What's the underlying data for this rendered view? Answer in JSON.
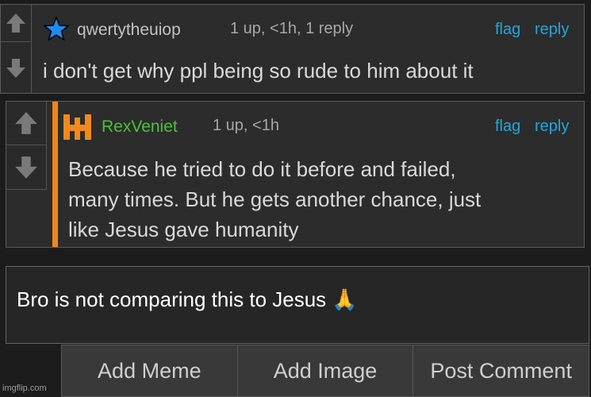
{
  "comments": [
    {
      "username": "qwertytheuiop",
      "meta": "1 up, <1h, 1 reply",
      "flag": "flag",
      "reply": "reply",
      "text": "i don't get why ppl being so rude to him about it"
    },
    {
      "username": "RexVeniet",
      "meta": "1 up, <1h",
      "flag": "flag",
      "reply": "reply",
      "lines": [
        "Because he tried to do it before and failed,",
        "many times. But he gets another chance, just",
        "like Jesus gave humanity"
      ]
    }
  ],
  "reply_box": {
    "text": "Bro is not comparing this to Jesus",
    "emoji": "🙏"
  },
  "actions": {
    "add_meme": "Add Meme",
    "add_image": "Add Image",
    "post_comment": "Post Comment"
  },
  "watermark": "imgflip.com",
  "colors": {
    "link": "#1fa7e0",
    "username2": "#4cc23a",
    "badge": "#f08a1c",
    "star": "#1d8cf0",
    "reply_accent": "#f0861a"
  }
}
